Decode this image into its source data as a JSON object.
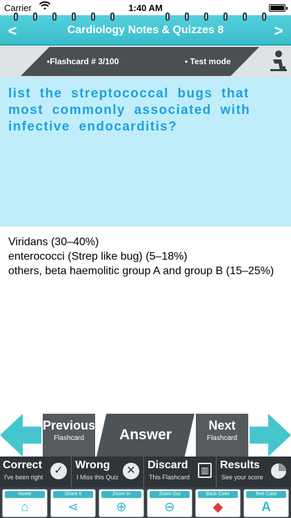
{
  "status_bar": {
    "carrier": "Carrier",
    "time": "1:40 AM",
    "battery_level": 1.0
  },
  "header": {
    "title": "Cardiology Notes & Quizzes 8",
    "prev_arrow": "<",
    "next_arrow": ">"
  },
  "info": {
    "flashcard_label": "•Flashcard #  3/100",
    "mode_label": "• Test mode"
  },
  "question": {
    "text": "list the streptococcal bugs that most commonly associated with infective endocarditis?"
  },
  "answer": {
    "lines": [
      "Viridans (30–40%)",
      "enterococci (Strep like bug) (5–18%)",
      "others, beta haemolitic group A and group B (15–25%)"
    ]
  },
  "navigation": {
    "previous": {
      "label": "Previous",
      "sub": "Flashcard"
    },
    "answer": {
      "label": "Answer"
    },
    "next": {
      "label": "Next",
      "sub": "Flashcard"
    }
  },
  "status_buttons": {
    "correct": {
      "label": "Correct",
      "sub": "I've been right",
      "icon": "check-icon"
    },
    "wrong": {
      "label": "Wrong",
      "sub": "I Miss this Quiz",
      "icon": "x-icon"
    },
    "discard": {
      "label": "Discard",
      "sub": "This Flashcard",
      "icon": "trash-icon"
    },
    "results": {
      "label": "Results",
      "sub": "See your score",
      "icon": "pie-chart-icon"
    }
  },
  "toolbar": {
    "home": {
      "label": "Home",
      "icon": "home-icon"
    },
    "share": {
      "label": "Share It",
      "icon": "share-icon"
    },
    "zoom_in": {
      "label": "Zoom In",
      "icon": "zoom-in-icon"
    },
    "zoom_out": {
      "label": "Zoom Out",
      "icon": "zoom-out-icon"
    },
    "back_color": {
      "label": "Back Color",
      "icon": "paint-bucket-icon"
    },
    "text_color": {
      "label": "Text Color",
      "icon": "text-color-icon"
    }
  },
  "colors": {
    "accent": "#45c6cf",
    "question_bg": "#bfeefa",
    "question_text": "#1ea0e0",
    "dark": "#2f3438"
  }
}
